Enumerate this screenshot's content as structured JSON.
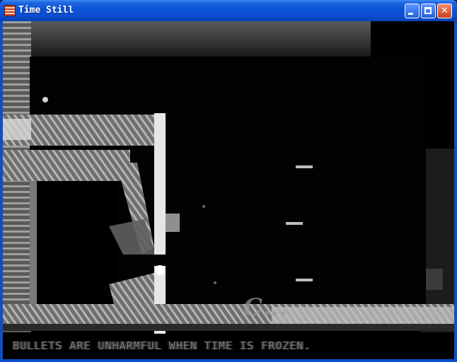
{
  "window": {
    "title": "Time Still"
  },
  "controls": {
    "minimize": "minimize",
    "maximize": "maximize",
    "close": "close"
  },
  "game": {
    "hint": "BULLETS ARE UNHARMFUL WHEN TIME IS FROZEN."
  }
}
